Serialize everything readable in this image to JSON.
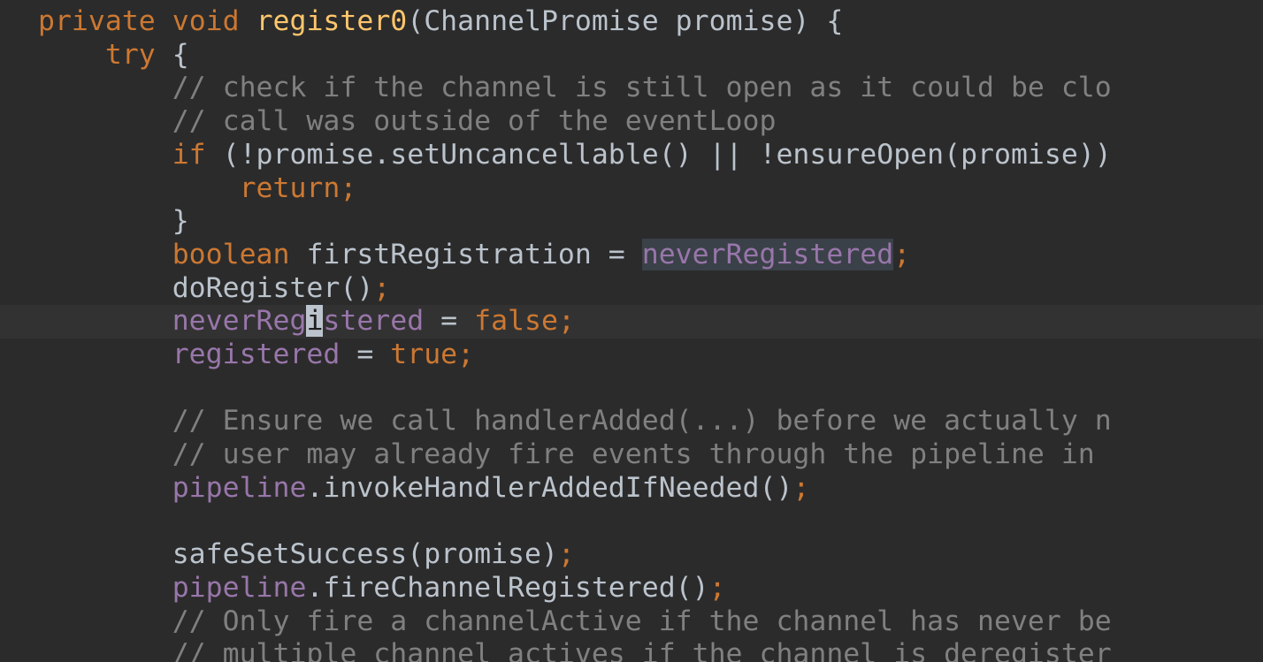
{
  "editor": {
    "language": "java",
    "colors": {
      "background": "#2b2b2b",
      "current_line": "#323232",
      "keyword": "#cc7832",
      "method_declaration": "#ffc66d",
      "field": "#9876aa",
      "comment": "#808080",
      "plain": "#bbc3cc",
      "usage_highlight": "#3b4148"
    },
    "current_line_index": 9,
    "caret": {
      "line": 9,
      "column": 16
    },
    "lines": [
      {
        "tokens": [
          {
            "t": "private",
            "k": "keyword"
          },
          {
            "t": " ",
            "k": "plain"
          },
          {
            "t": "void",
            "k": "keyword"
          },
          {
            "t": " ",
            "k": "plain"
          },
          {
            "t": "register0",
            "k": "method"
          },
          {
            "t": "(ChannelPromise promise) {",
            "k": "plain"
          }
        ]
      },
      {
        "tokens": [
          {
            "t": "    ",
            "k": "plain"
          },
          {
            "t": "try",
            "k": "keyword"
          },
          {
            "t": " {",
            "k": "plain"
          }
        ]
      },
      {
        "tokens": [
          {
            "t": "        ",
            "k": "plain"
          },
          {
            "t": "// check if the channel is still open as it could be clo",
            "k": "comment"
          }
        ]
      },
      {
        "tokens": [
          {
            "t": "        ",
            "k": "plain"
          },
          {
            "t": "// call was outside of the eventLoop",
            "k": "comment"
          }
        ]
      },
      {
        "tokens": [
          {
            "t": "        ",
            "k": "plain"
          },
          {
            "t": "if",
            "k": "keyword"
          },
          {
            "t": " (!promise.setUncancellable() || !ensureOpen(promise))",
            "k": "plain"
          }
        ]
      },
      {
        "tokens": [
          {
            "t": "            ",
            "k": "plain"
          },
          {
            "t": "return",
            "k": "keyword"
          },
          {
            "t": ";",
            "k": "punct"
          }
        ]
      },
      {
        "tokens": [
          {
            "t": "        ",
            "k": "plain"
          },
          {
            "t": "}",
            "k": "plain"
          }
        ]
      },
      {
        "tokens": [
          {
            "t": "        ",
            "k": "plain"
          },
          {
            "t": "boolean",
            "k": "keyword"
          },
          {
            "t": " firstRegistration = ",
            "k": "plain"
          },
          {
            "t": "neverRegistered",
            "k": "field",
            "usage": true
          },
          {
            "t": ";",
            "k": "punct"
          }
        ]
      },
      {
        "tokens": [
          {
            "t": "        ",
            "k": "plain"
          },
          {
            "t": "doRegister()",
            "k": "plain"
          },
          {
            "t": ";",
            "k": "punct"
          }
        ]
      },
      {
        "tokens": [
          {
            "t": "        ",
            "k": "plain"
          },
          {
            "t": "neverReg",
            "k": "field"
          },
          {
            "t": "i",
            "k": "field",
            "caret": true
          },
          {
            "t": "stered",
            "k": "field"
          },
          {
            "t": " = ",
            "k": "plain"
          },
          {
            "t": "false",
            "k": "keyword"
          },
          {
            "t": ";",
            "k": "punct"
          }
        ]
      },
      {
        "tokens": [
          {
            "t": "        ",
            "k": "plain"
          },
          {
            "t": "registered",
            "k": "field"
          },
          {
            "t": " = ",
            "k": "plain"
          },
          {
            "t": "true",
            "k": "keyword"
          },
          {
            "t": ";",
            "k": "punct"
          }
        ]
      },
      {
        "tokens": [
          {
            "t": "",
            "k": "plain"
          }
        ]
      },
      {
        "tokens": [
          {
            "t": "        ",
            "k": "plain"
          },
          {
            "t": "// Ensure we call handlerAdded(...) before we actually n",
            "k": "comment"
          }
        ]
      },
      {
        "tokens": [
          {
            "t": "        ",
            "k": "plain"
          },
          {
            "t": "// user may already fire events through the pipeline in",
            "k": "comment"
          }
        ]
      },
      {
        "tokens": [
          {
            "t": "        ",
            "k": "plain"
          },
          {
            "t": "pipeline",
            "k": "field"
          },
          {
            "t": ".invokeHandlerAddedIfNeeded()",
            "k": "plain"
          },
          {
            "t": ";",
            "k": "punct"
          }
        ]
      },
      {
        "tokens": [
          {
            "t": "",
            "k": "plain"
          }
        ]
      },
      {
        "tokens": [
          {
            "t": "        ",
            "k": "plain"
          },
          {
            "t": "safeSetSuccess(promise)",
            "k": "plain"
          },
          {
            "t": ";",
            "k": "punct"
          }
        ]
      },
      {
        "tokens": [
          {
            "t": "        ",
            "k": "plain"
          },
          {
            "t": "pipeline",
            "k": "field"
          },
          {
            "t": ".fireChannelRegistered()",
            "k": "plain"
          },
          {
            "t": ";",
            "k": "punct"
          }
        ]
      },
      {
        "tokens": [
          {
            "t": "        ",
            "k": "plain"
          },
          {
            "t": "// Only fire a channelActive if the channel has never be",
            "k": "comment"
          }
        ]
      },
      {
        "tokens": [
          {
            "t": "        ",
            "k": "plain"
          },
          {
            "t": "// multiple channel actives if the channel is deregister",
            "k": "comment"
          }
        ]
      }
    ]
  }
}
